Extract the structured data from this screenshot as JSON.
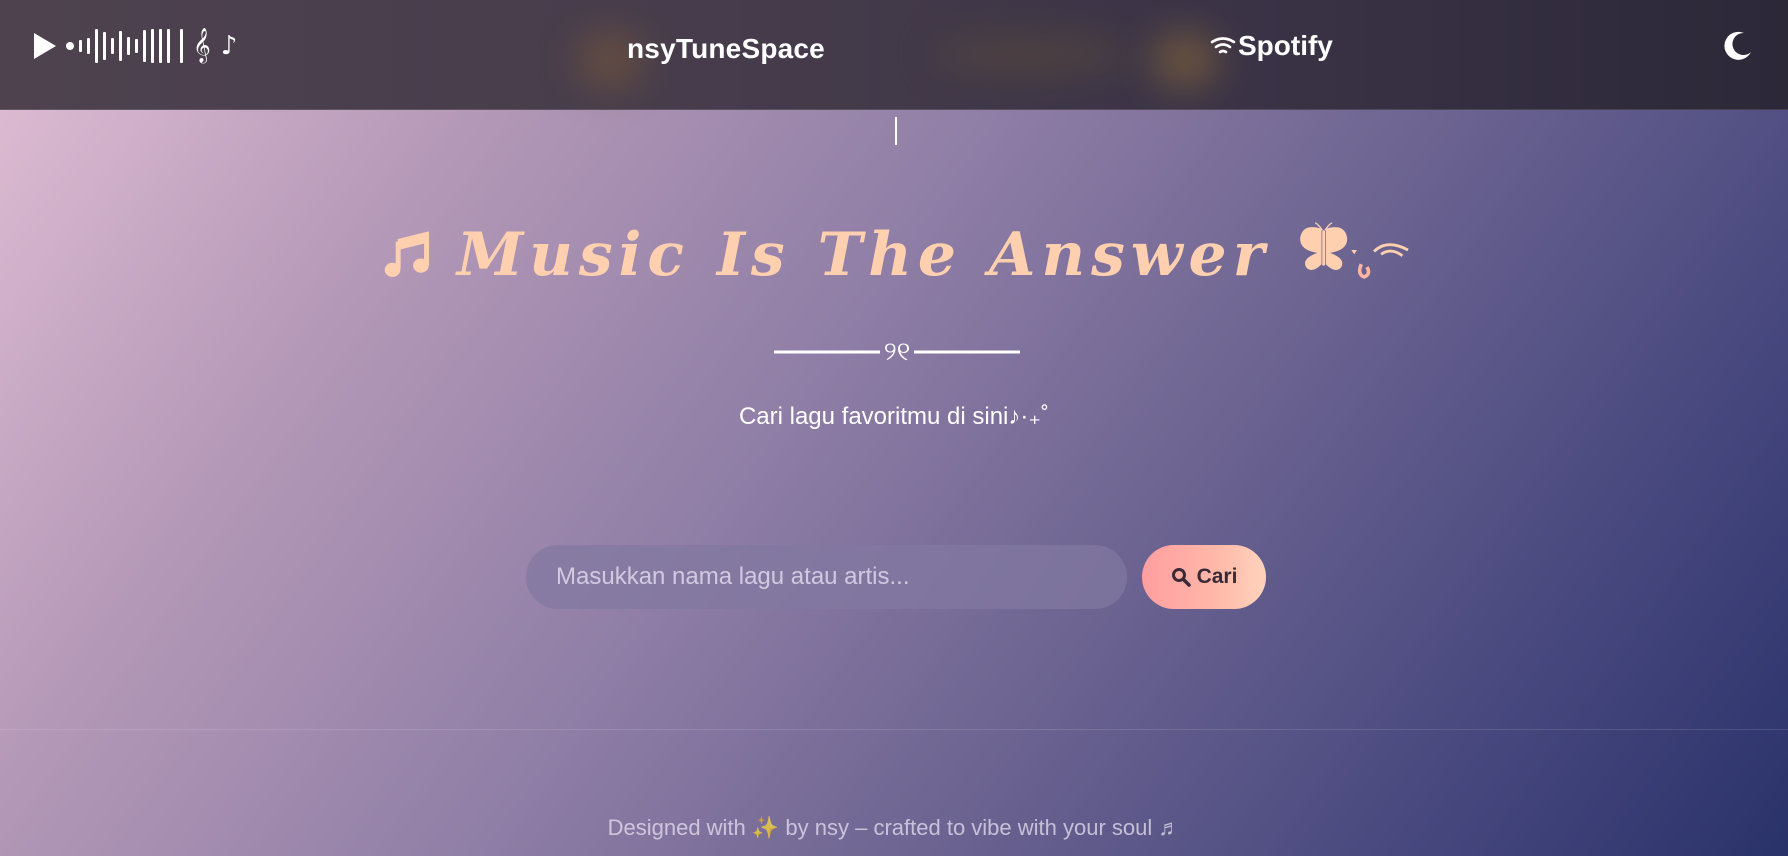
{
  "header": {
    "logo_notes": "♪",
    "logo_clef": "𝄞",
    "site_title": "nsyTuneSpace",
    "spotify_label": "Spotify",
    "icons": {
      "wifi": "wifi-icon",
      "theme_toggle": "moon-icon",
      "play": "play-icon"
    }
  },
  "hero": {
    "title": "Music Is The Answer",
    "title_prefix_icon": "music-note-icon",
    "title_suffix_icon": "butterfly-icon",
    "divider_symbol": "୨୧",
    "subtitle": "Cari lagu favoritmu di sini♪·₊˚"
  },
  "search": {
    "placeholder": "Masukkan nama lagu atau artis...",
    "value": "",
    "button_label": "Cari",
    "button_icon": "search-icon"
  },
  "footer": {
    "text": "Designed with ✨ by nsy – crafted to vibe with your soul ♬"
  },
  "colors": {
    "accent_peach": "#ffd0b0",
    "button_gradient_start": "#ff9ea0",
    "button_gradient_end": "#ffd3bd",
    "header_bg": "#463c4b"
  }
}
